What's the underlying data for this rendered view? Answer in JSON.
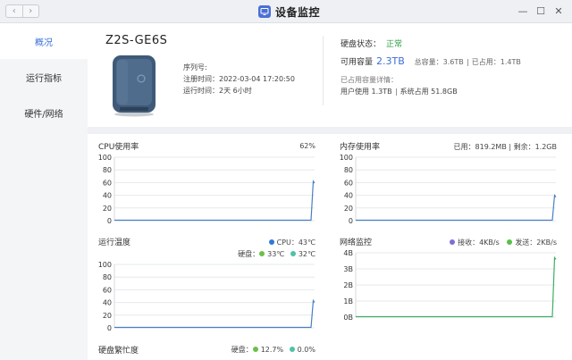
{
  "window": {
    "title": "设备监控",
    "back_icon": "chevron-left-icon",
    "forward_icon": "chevron-right-icon"
  },
  "sidebar": {
    "items": [
      {
        "label": "概况",
        "active": true
      },
      {
        "label": "运行指标",
        "active": false
      },
      {
        "label": "硬件/网络",
        "active": false
      }
    ]
  },
  "device": {
    "name": "Z2S-GE6S",
    "serial_label": "序列号:",
    "register_time": "注册时间：2022-03-04 17:20:50",
    "run_time": "运行时间：2天 6小时"
  },
  "disk": {
    "status_label": "硬盘状态：",
    "status_value": "正常",
    "available_label": "可用容量",
    "available_value": "2.3TB",
    "total": "总容量：3.6TB",
    "used": "已占用：1.4TB",
    "used_detail_label": "已占用容量详情：",
    "user_used": "用户使用 1.3TB",
    "system_used": "系统占用 51.8GB"
  },
  "colors": {
    "accent": "#3a6fd8",
    "ok": "#2f9e44",
    "cpu": "#2e7bd6",
    "disk1": "#6cc04a",
    "disk2": "#4ec2a8",
    "rx": "#7b6fd6",
    "tx": "#57c04a",
    "line": "#4a7fc4",
    "net_line": "#3fae62"
  },
  "charts": {
    "cpu": {
      "title": "CPU使用率",
      "note": "62%",
      "y_ticks": [
        "100",
        "80",
        "60",
        "40",
        "20",
        "0"
      ],
      "ylim": [
        0,
        100
      ],
      "current": 62
    },
    "memory": {
      "title": "内存使用率",
      "note": "已用：819.2MB | 剩余：1.2GB",
      "y_ticks": [
        "100",
        "80",
        "60",
        "40",
        "20",
        "0"
      ],
      "ylim": [
        0,
        100
      ],
      "current": 40
    },
    "temperature": {
      "title": "运行温度",
      "legend_cpu": "CPU：43℃",
      "legend_disk_label": "硬盘：",
      "legend_disk1": "33℃",
      "legend_disk2": "32℃",
      "y_ticks": [
        "100",
        "80",
        "60",
        "40",
        "20",
        "0"
      ],
      "ylim": [
        0,
        100
      ],
      "current": 43
    },
    "network": {
      "title": "网络监控",
      "legend_rx": "接收：4KB/s",
      "legend_tx": "发送：2KB/s",
      "y_ticks": [
        "4B",
        "3B",
        "2B",
        "1B",
        "0B"
      ],
      "ylim": [
        0,
        4
      ],
      "current": 3.7
    },
    "disk_busy": {
      "title": "硬盘繁忙度",
      "legend_label": "硬盘：",
      "legend_disk1": "12.7%",
      "legend_disk2": "0.0%"
    }
  }
}
